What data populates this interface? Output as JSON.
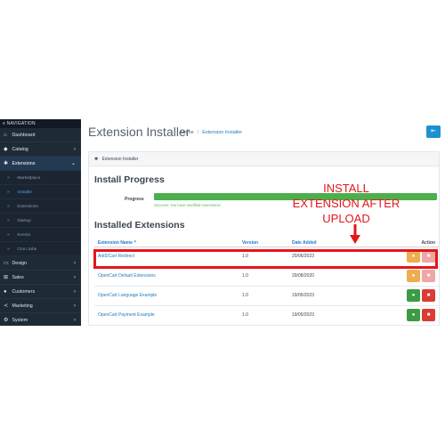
{
  "sidebar": {
    "header": "≡ NAVIGATION",
    "items": [
      {
        "label": "Dashboard",
        "icon": "home-icon",
        "glyph": "⌂",
        "chevron": ""
      },
      {
        "label": "Catalog",
        "icon": "tag-icon",
        "glyph": "◆",
        "chevron": "›"
      },
      {
        "label": "Extensions",
        "icon": "puzzle-icon",
        "glyph": "✱",
        "chevron": "⌄"
      },
      {
        "label": "Design",
        "icon": "monitor-icon",
        "glyph": "▭",
        "chevron": "›"
      },
      {
        "label": "Sales",
        "icon": "cart-icon",
        "glyph": "⊞",
        "chevron": "›"
      },
      {
        "label": "Customers",
        "icon": "user-icon",
        "glyph": "●",
        "chevron": "›"
      },
      {
        "label": "Marketing",
        "icon": "share-icon",
        "glyph": "≺",
        "chevron": "›"
      },
      {
        "label": "System",
        "icon": "gear-icon",
        "glyph": "⚙",
        "chevron": "›"
      }
    ],
    "subitems": [
      {
        "label": "Marketplace",
        "glyph": "»"
      },
      {
        "label": "Installer",
        "glyph": "»"
      },
      {
        "label": "Extensions",
        "glyph": "»"
      },
      {
        "label": "Startup",
        "glyph": "»"
      },
      {
        "label": "Events",
        "glyph": "»"
      },
      {
        "label": "Cron Jobs",
        "glyph": "»"
      }
    ]
  },
  "header": {
    "title": "Extension Installer",
    "breadcrumb": [
      "Home",
      "Extension Installer"
    ],
    "back_glyph": "⇤"
  },
  "card": {
    "title": "Extension Installer",
    "icon_glyph": "✱"
  },
  "progress": {
    "section_title": "Install Progress",
    "label": "Progress",
    "percent": 100,
    "message": "Success: You have modified extensions!",
    "bar_color": "#4cae4c"
  },
  "installed": {
    "section_title": "Installed Extensions",
    "columns": [
      "Extension Name ^",
      "Version",
      "Date Added",
      "Action"
    ],
    "rows": [
      {
        "name": "Add2Cart Redirect",
        "version": "1.0",
        "date": "20/06/2023",
        "first_action": "warning",
        "second_action": "disabled-delete"
      },
      {
        "name": "OpenCart Default Extensions",
        "version": "1.0",
        "date": "29/08/2020",
        "first_action": "warning",
        "second_action": "disabled-delete"
      },
      {
        "name": "OpenCart Language Example",
        "version": "1.0",
        "date": "19/05/2023",
        "first_action": "install",
        "second_action": "delete"
      },
      {
        "name": "OpenCart Payment Example",
        "version": "1.0",
        "date": "19/05/2023",
        "first_action": "install",
        "second_action": "delete"
      }
    ]
  },
  "annotation": {
    "lines": [
      "INSTALL",
      "EXTENSION AFTER",
      "UPLOAD"
    ],
    "color": "#e4161b"
  },
  "colors": {
    "sidebar_bg": "#1f2a37",
    "accent_blue": "#1e91cf",
    "success_green": "#4cae4c",
    "danger_red": "#dd3b34",
    "warning_orange": "#f0ad4e"
  }
}
